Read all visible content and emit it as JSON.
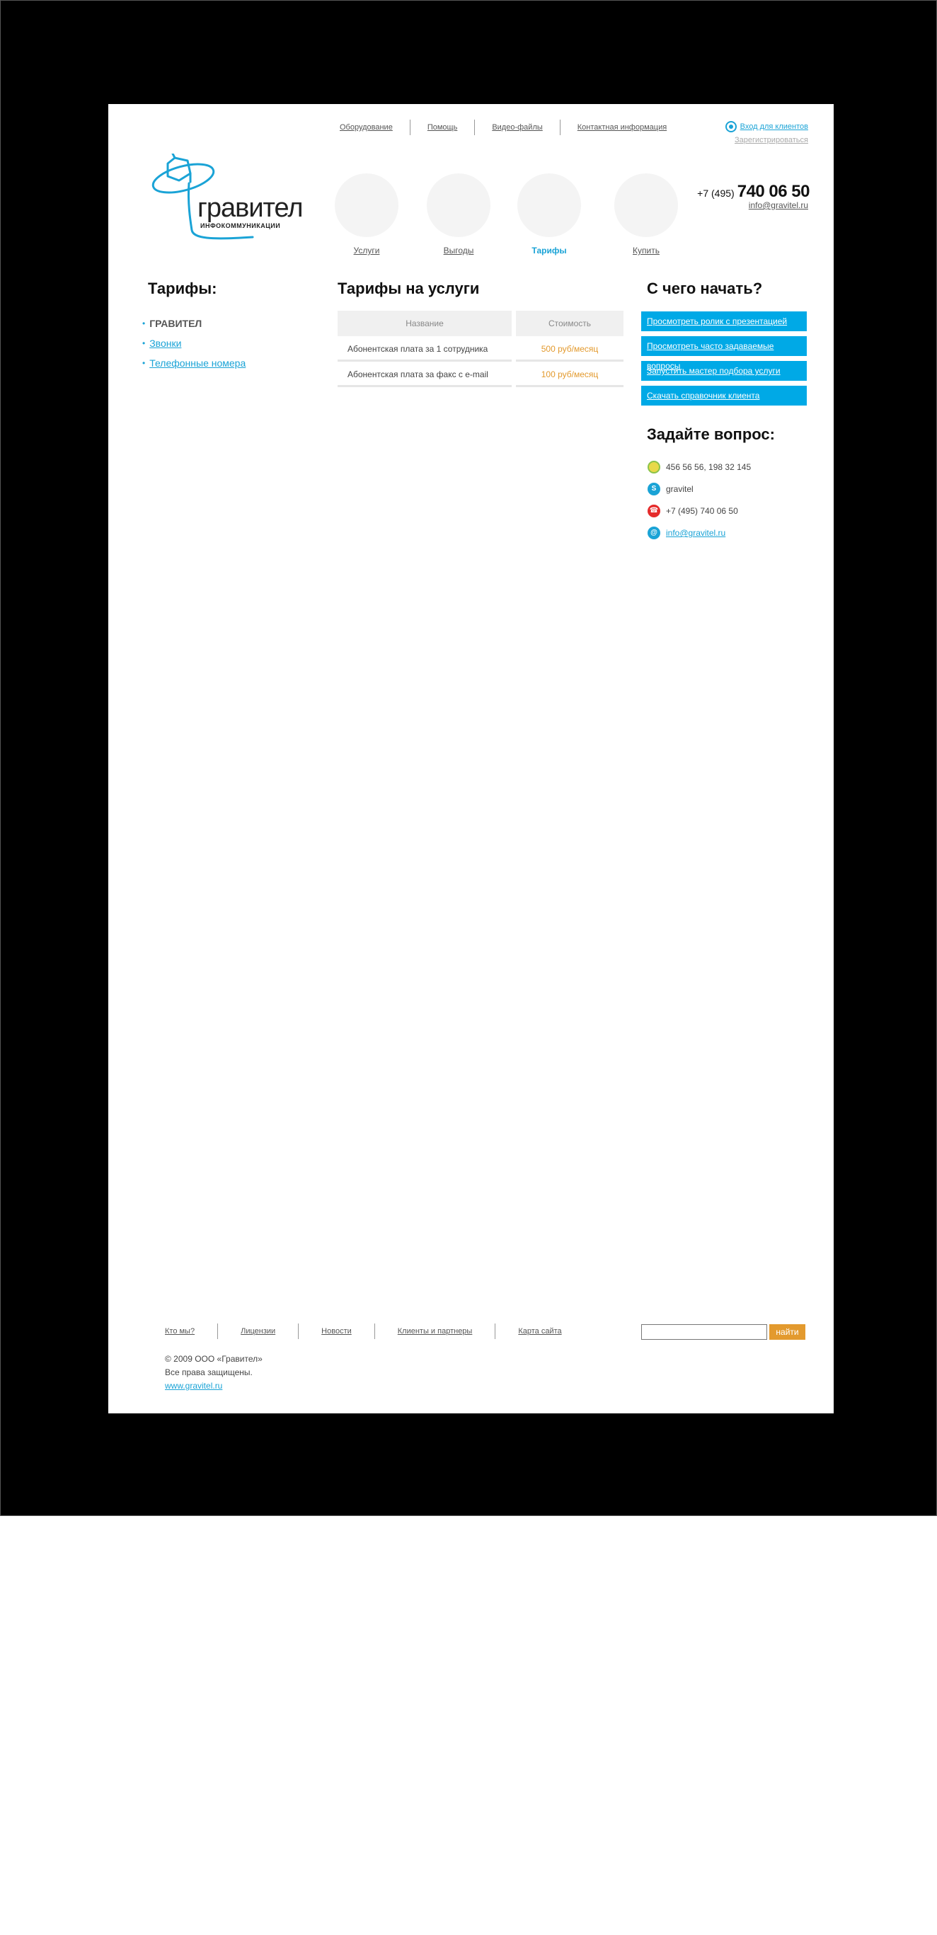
{
  "top_nav": [
    "Оборудование",
    "Помощь",
    "Видео-файлы",
    "Контактная информация"
  ],
  "login": {
    "label": "Вход для клиентов",
    "register": "Зарегистрироваться"
  },
  "logo": {
    "word": "гравител",
    "sub": "ИНФОКОММУНИКАЦИИ"
  },
  "main_nav": [
    {
      "label": "Услуги",
      "active": false
    },
    {
      "label": "Выгоды",
      "active": false
    },
    {
      "label": "Тарифы",
      "active": true
    },
    {
      "label": "Купить",
      "active": false
    }
  ],
  "contact_header": {
    "code": "+7 (495)",
    "number": "740 06 50",
    "email": "info@gravitel.ru"
  },
  "left": {
    "title": "Тарифы:",
    "items": [
      "ГРАВИТЕЛ",
      "Звонки",
      "Телефонные номера"
    ]
  },
  "center": {
    "title": "Тарифы на услуги",
    "columns": [
      "Название",
      "Стоимость"
    ],
    "rows": [
      [
        "Абонентская плата за 1 сотрудника",
        "500 руб/месяц"
      ],
      [
        "Абонентская плата за факс с e-mail",
        "100 руб/месяц"
      ]
    ]
  },
  "right": {
    "title": "С чего начать?",
    "buttons": [
      "Просмотреть ролик с презентацией",
      "Просмотреть часто задаваемые вопросы",
      "Запустить мастер подбора услуги",
      "Скачать справочник клиента"
    ],
    "ask_title": "Задайте вопрос:",
    "contacts": {
      "icq": "456 56 56, 198 32 145",
      "skype": "gravitel",
      "phone": "+7 (495) 740 06 50",
      "email": "info@gravitel.ru"
    }
  },
  "footer": {
    "nav": [
      "Кто мы?",
      "Лицензии",
      "Новости",
      "Клиенты и партнеры",
      "Карта сайта"
    ],
    "search_button": "найти",
    "copyright": "© 2009 ООО «Гравител»",
    "rights": "Все права защищены.",
    "site": "www.gravitel.ru"
  },
  "colors": {
    "accent": "#00a9e6",
    "price": "#e39a2e",
    "frame": "#000000"
  }
}
